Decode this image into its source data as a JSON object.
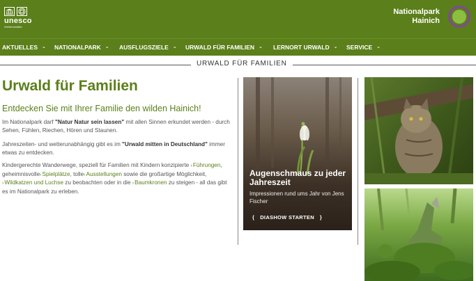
{
  "header": {
    "unesco_word": "unesco",
    "unesco_sub": "Welterbestätte",
    "park_line1": "Nationalpark",
    "park_line2": "Hainich",
    "colors": {
      "header_bg": "#5b7f1a",
      "logo_ring": "#7d4e8a",
      "logo_inner": "#8cbf3f"
    }
  },
  "nav": {
    "items": [
      {
        "label": "AKTUELLES"
      },
      {
        "label": "NATIONALPARK"
      },
      {
        "label": "AUSFLUGSZIELE"
      },
      {
        "label": "URWALD FÜR FAMILIEN"
      },
      {
        "label": "LERNORT URWALD"
      },
      {
        "label": "SERVICE"
      }
    ],
    "chevron": "⌄"
  },
  "section_title": "URWALD FÜR FAMILIEN",
  "main": {
    "heading": "Urwald für Familien",
    "lead": "Entdecken Sie mit Ihrer Familie den wilden Hainich!",
    "p1_pre": "Im Nationalpark darf ",
    "p1_bold": "\"Natur Natur sein lassen\"",
    "p1_post": " mit allen Sinnen erkundet werden - durch Sehen, Fühlen, Riechen, Hören und Staunen.",
    "p2_pre": "Jahreszeiten- und wetterunabhängig gibt es im ",
    "p2_bold": "\"Urwald mitten in Deutschland\"",
    "p2_post": " immer etwas zu entdecken.",
    "p3_pre": "Kindergerechte Wanderwege, speziell für Familien mit Kindern konzipierte ",
    "link_fuehrungen": "Führungen",
    "p3_mid1": ", geheimnisvolle",
    "link_spielplaetze": "Spielplätze",
    "p3_mid2": ", tolle",
    "link_ausstellungen": "Ausstellungen",
    "p3_mid3": " sowie die großartige Möglichkeit, ",
    "link_wildkatzen": "Wildkatzen und Luchse",
    "p3_mid4": " zu beobachten oder in die ",
    "link_baumkronen": "Baumkronen",
    "p3_post": " zu steigen - all das gibt es im Nationalpark zu erleben.",
    "link_arrow": "›"
  },
  "card": {
    "title": "Augenschmaus zu jeder Jahreszeit",
    "subtitle": "Impressionen rund ums Jahr von Jens Fischer",
    "button_open": "{",
    "button_label": "DIASHOW STARTEN",
    "button_close": "}"
  }
}
